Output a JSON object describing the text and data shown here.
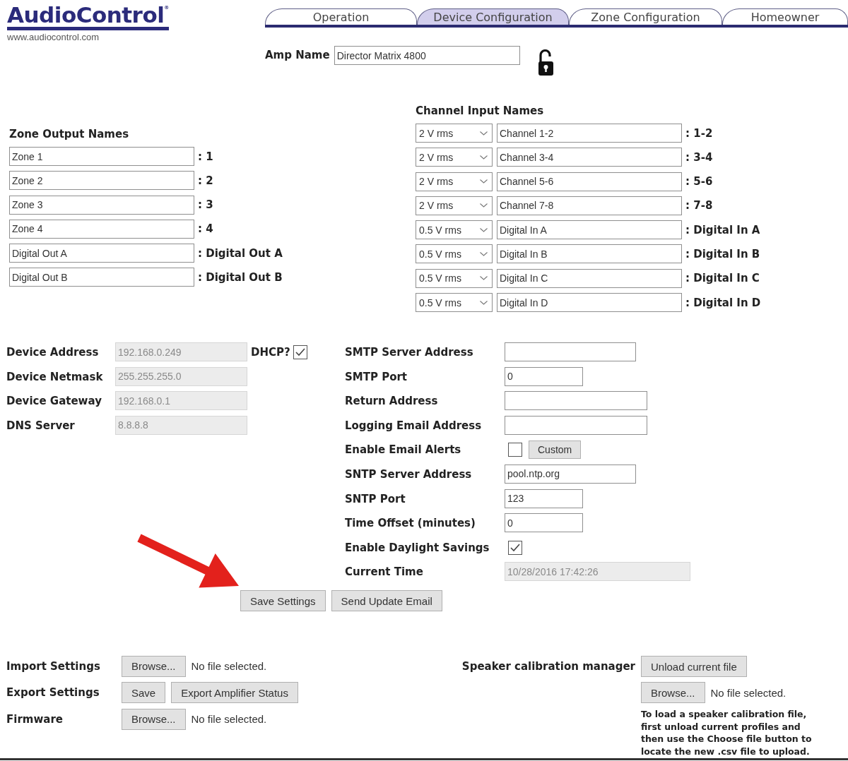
{
  "header": {
    "logo": "AudioControl$^{®}$",
    "website": "www.audiocontrol.com"
  },
  "tabs": [
    {
      "label": "Operation",
      "selected": false
    },
    {
      "label": "Device Configuration",
      "selected": true
    },
    {
      "label": "Zone Configuration",
      "selected": false
    },
    {
      "label": "Homeowner",
      "selected": false
    }
  ],
  "amp_name": {
    "label": "Amp Name",
    "value": "Director Matrix 4800",
    "locked": false
  },
  "zone_outputs": {
    "title": "Zone Output Names",
    "rows": [
      {
        "value": "Zone 1",
        "label": ": 1"
      },
      {
        "value": "Zone 2",
        "label": ": 2"
      },
      {
        "value": "Zone 3",
        "label": ": 3"
      },
      {
        "value": "Zone 4",
        "label": ": 4"
      },
      {
        "value": "Digital Out A",
        "label": ": Digital Out A"
      },
      {
        "value": "Digital Out B",
        "label": ": Digital Out B"
      }
    ]
  },
  "channel_inputs": {
    "title": "Channel Input Names",
    "rows": [
      {
        "sensitivity": "2 V rms",
        "value": "Channel 1-2",
        "label": ": 1-2"
      },
      {
        "sensitivity": "2 V rms",
        "value": "Channel 3-4",
        "label": ": 3-4"
      },
      {
        "sensitivity": "2 V rms",
        "value": "Channel 5-6",
        "label": ": 5-6"
      },
      {
        "sensitivity": "2 V rms",
        "value": "Channel 7-8",
        "label": ": 7-8"
      },
      {
        "sensitivity": "0.5 V rms",
        "value": "Digital In A",
        "label": ": Digital In A"
      },
      {
        "sensitivity": "0.5 V rms",
        "value": "Digital In B",
        "label": ": Digital In B"
      },
      {
        "sensitivity": "0.5 V rms",
        "value": "Digital In C",
        "label": ": Digital In C"
      },
      {
        "sensitivity": "0.5 V rms",
        "value": "Digital In D",
        "label": ": Digital In D"
      }
    ]
  },
  "network": {
    "fields": [
      {
        "label": "Device Address",
        "value": "192.168.0.249",
        "disabled": true
      },
      {
        "label": "Device Netmask",
        "value": "255.255.255.0",
        "disabled": true
      },
      {
        "label": "Device Gateway",
        "value": "192.168.0.1",
        "disabled": true
      },
      {
        "label": "DNS Server",
        "value": "8.8.8.8",
        "disabled": true
      }
    ],
    "dhcp": {
      "label": "DHCP?",
      "checked": true
    }
  },
  "email": {
    "fields": [
      {
        "kind": "host",
        "label": "SMTP Server Address",
        "disabled": false
      },
      {
        "kind": "number",
        "label": "SMTP Port",
        "value": "0",
        "disabled": false
      },
      {
        "kind": "email",
        "label": "Return Address",
        "disabled": false
      },
      {
        "kind": "email",
        "label": "Logging Email Address",
        "disabled": false
      },
      {
        "kind": "checkbox",
        "label": "Enable Email Alerts",
        "checked": false,
        "button": "Custom"
      },
      {
        "kind": "host",
        "label": "SNTP Server Address",
        "value": "pool.ntp.org",
        "disabled": false
      },
      {
        "kind": "number",
        "label": "SNTP Port",
        "value": "123",
        "disabled": false
      },
      {
        "kind": "number",
        "label": "Time Offset (minutes)",
        "value": "0",
        "disabled": false
      },
      {
        "kind": "checkbox",
        "label": "Enable Daylight Savings",
        "checked": true
      },
      {
        "kind": "datetime",
        "label": "Current Time",
        "value": "10/28/2016 17:42:26",
        "disabled": true
      }
    ]
  },
  "actions": [
    "Save Settings",
    "Send Update Email"
  ],
  "file_settings": [
    {
      "label": "Import Settings",
      "buttons": [
        "Browse..."
      ],
      "status": "No file selected."
    },
    {
      "label": "Export Settings",
      "buttons": [
        "Save",
        "Export Amplifier Status"
      ]
    },
    {
      "label": "Firmware",
      "buttons": [
        "Browse..."
      ],
      "status": "No file selected."
    }
  ],
  "speaker_calibration": {
    "label": "Speaker calibration manager",
    "unload_button": "Unload current file",
    "browse_button": "Browse...",
    "status": "No file selected.",
    "note": "To load a speaker calibration file, first unload current profiles and then use the Choose file button to locate the new .csv file to upload."
  }
}
